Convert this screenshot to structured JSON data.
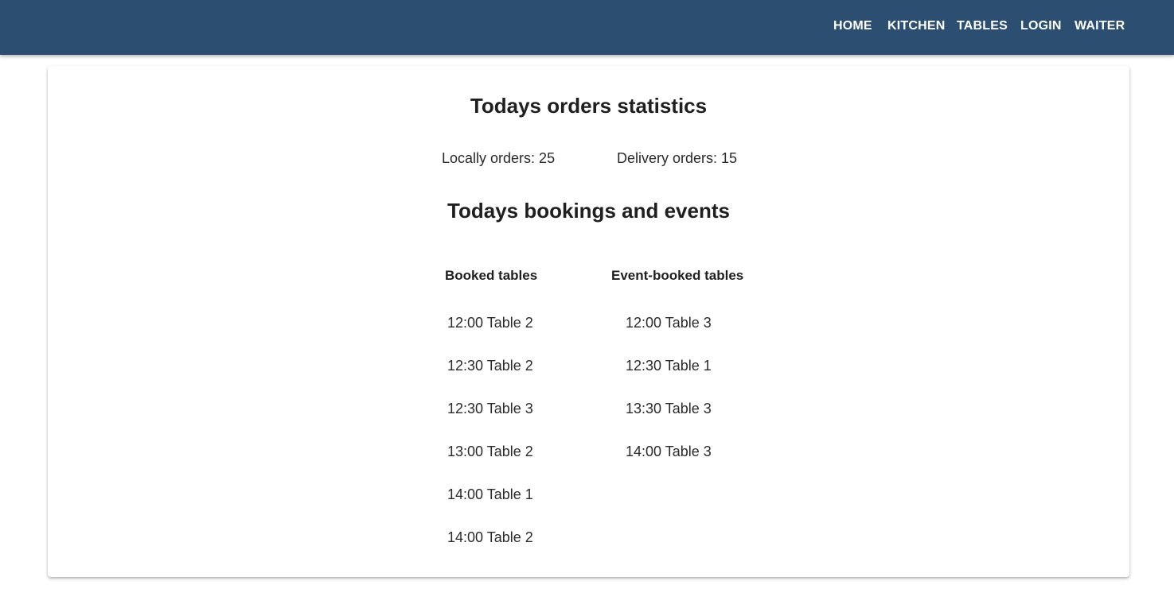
{
  "nav": {
    "items": [
      {
        "label": "HOME"
      },
      {
        "label": "KITCHEN"
      },
      {
        "label": "TABLES"
      },
      {
        "label": "LOGIN"
      },
      {
        "label": "WAITER"
      }
    ]
  },
  "orders": {
    "title": "Todays orders statistics",
    "local_label": "Locally orders: 25",
    "delivery_label": "Delivery orders: 15"
  },
  "bookings": {
    "title": "Todays bookings and events",
    "booked_header": "Booked tables",
    "event_header": "Event-booked tables",
    "booked": [
      "12:00 Table 2",
      "12:30 Table 2",
      "12:30 Table 3",
      "13:00 Table 2",
      "14:00 Table 1",
      "14:00 Table 2"
    ],
    "events": [
      "12:00 Table 3",
      "12:30 Table 1",
      "13:30 Table 3",
      "14:00 Table 3"
    ]
  },
  "colors": {
    "toolbar": "#2c4f71",
    "nav_text": "#ffffff"
  }
}
